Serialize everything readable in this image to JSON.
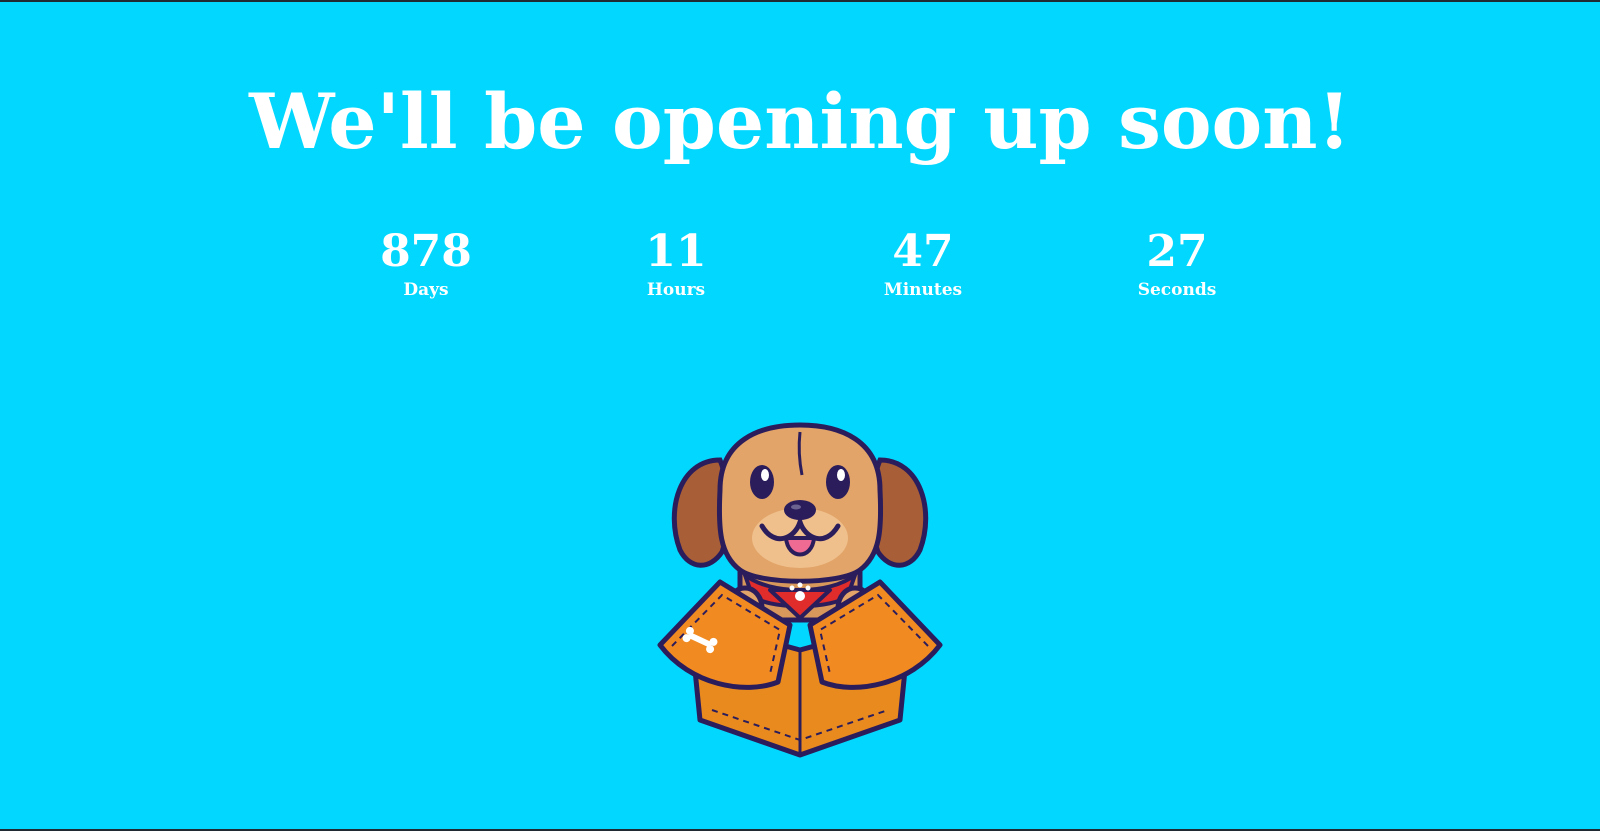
{
  "headline": "We'll be opening up soon!",
  "countdown": [
    {
      "value": "878",
      "label": "Days"
    },
    {
      "value": "11",
      "label": "Hours"
    },
    {
      "value": "47",
      "label": "Minutes"
    },
    {
      "value": "27",
      "label": "Seconds"
    }
  ],
  "colors": {
    "background": "#02d8ff",
    "text": "#ffffff"
  },
  "illustration": {
    "icon": "dog-in-box-illustration"
  }
}
